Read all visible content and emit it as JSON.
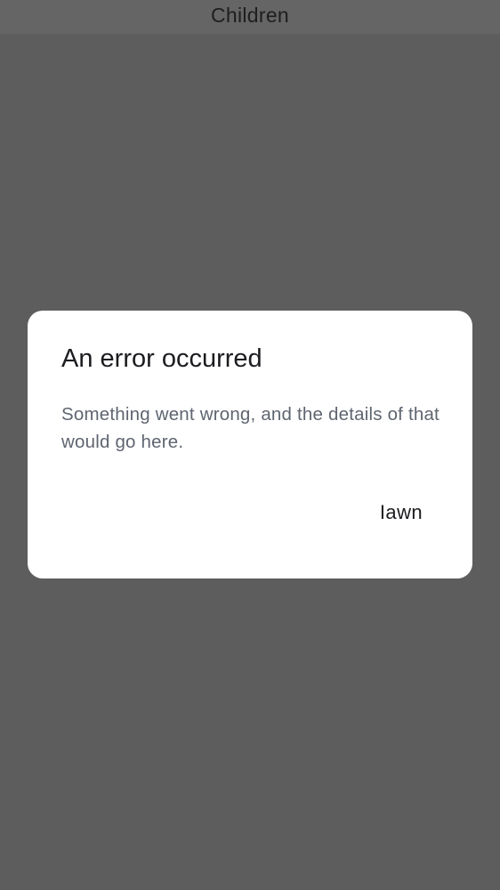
{
  "header": {
    "title": "Children"
  },
  "dialog": {
    "title": "An error occurred",
    "message": "Something went wrong, and the details of that would go here.",
    "button_label": "Iawn"
  }
}
